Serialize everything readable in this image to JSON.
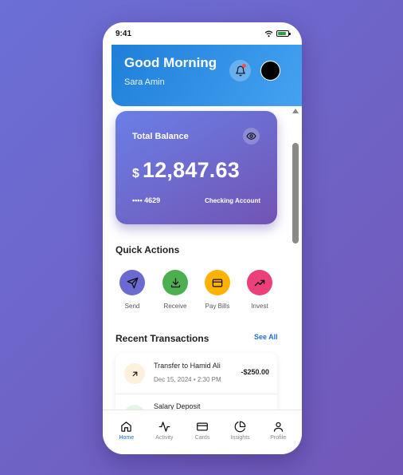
{
  "status_bar": {
    "time": "9:41"
  },
  "header": {
    "greeting": "Good Morning",
    "username": "Sara Amin"
  },
  "balance_card": {
    "label": "Total Balance",
    "currency_symbol": "$",
    "amount": "12,847.63",
    "card_number": "•••• 4629",
    "account_type": "Checking Account"
  },
  "quick_actions": {
    "title": "Quick Actions",
    "items": [
      {
        "label": "Send",
        "icon": "send-icon",
        "color": "#6a6ad0"
      },
      {
        "label": "Receive",
        "icon": "download-icon",
        "color": "#4caf50"
      },
      {
        "label": "Pay Bills",
        "icon": "card-icon",
        "color": "#ffb300"
      },
      {
        "label": "Invest",
        "icon": "trending-up-icon",
        "color": "#ec407a"
      }
    ]
  },
  "recent_transactions": {
    "title": "Recent Transactions",
    "see_all": "See All",
    "items": [
      {
        "name": "Transfer to Hamid Ali",
        "date": "Dec 15, 2024 • 2:30 PM",
        "amount": "-$250.00",
        "icon": "arrow-up-right-icon"
      },
      {
        "name": "Salary Deposit",
        "date": "",
        "amount": ""
      }
    ]
  },
  "tab_bar": {
    "tabs": [
      {
        "label": "Home",
        "icon": "home-icon",
        "active": true
      },
      {
        "label": "Activity",
        "icon": "activity-icon",
        "active": false
      },
      {
        "label": "Cards",
        "icon": "credit-card-icon",
        "active": false
      },
      {
        "label": "Insights",
        "icon": "pie-chart-icon",
        "active": false
      },
      {
        "label": "Profile",
        "icon": "user-icon",
        "active": false
      }
    ]
  },
  "colors": {
    "accent": "#1e6fd9",
    "header_gradient_start": "#1f7fd8",
    "header_gradient_end": "#45a2f2",
    "card_gradient_start": "#6a7fe6",
    "card_gradient_end": "#7254b4"
  }
}
